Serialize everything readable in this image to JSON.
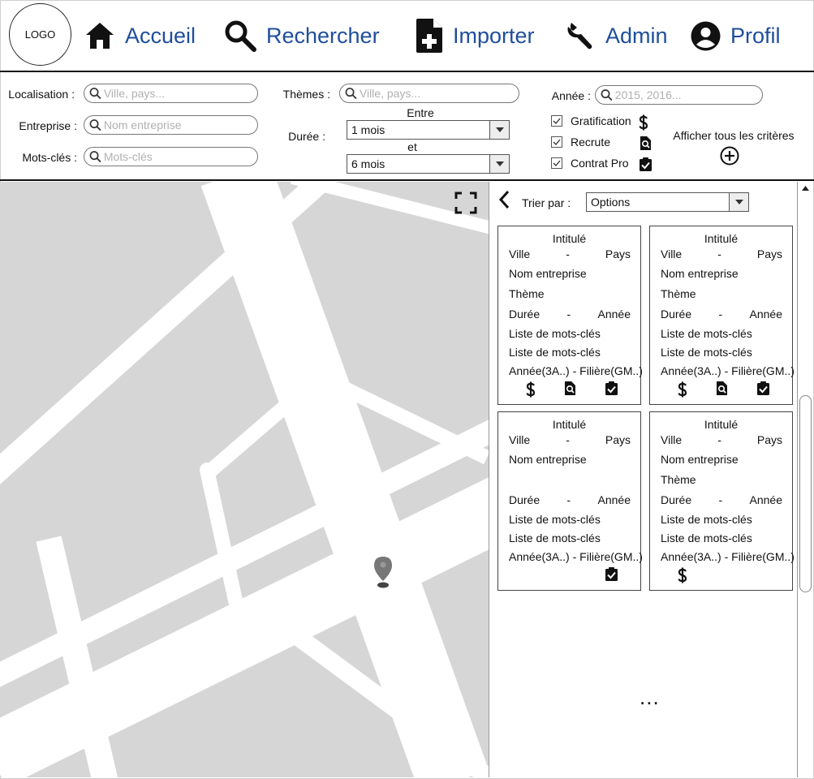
{
  "logo": "LOGO",
  "nav": {
    "home": "Accueil",
    "search": "Rechercher",
    "import": "Importer",
    "admin": "Admin",
    "profile": "Profil"
  },
  "filters": {
    "location_label": "Localisation :",
    "location_placeholder": "Ville, pays...",
    "company_label": "Entreprise :",
    "company_placeholder": "Nom entreprise",
    "keywords_label": "Mots-clés :",
    "keywords_placeholder": "Mots-clés",
    "themes_label": "Thèmes :",
    "themes_placeholder": "Ville, pays...",
    "duration_label": "Durée :",
    "between_label": "Entre",
    "and_label": "et",
    "duration_min": "1 mois",
    "duration_max": "6 mois",
    "year_label": "Année :",
    "year_placeholder": "2015, 2016...",
    "gratification_label": "Gratification",
    "recruits_label": "Recrute",
    "contract_label": "Contrat Pro",
    "gratification_checked": true,
    "recruits_checked": true,
    "contract_checked": true,
    "show_all_label": "Afficher tous les critères"
  },
  "results": {
    "sort_label": "Trier par :",
    "sort_value": "Options",
    "more": "...",
    "cards": [
      {
        "title": "Intitulé",
        "city": "Ville",
        "dash1": "-",
        "country": "Pays",
        "company": "Nom entreprise",
        "theme": "Thème",
        "duration": "Durée",
        "dash2": "-",
        "year": "Année",
        "keywords1": "Liste de mots-clés",
        "keywords2": "Liste de mots-clés",
        "program": "Année(3A..) - Filière(GM..)",
        "icons": [
          "dollar-icon",
          "recruit-search-icon",
          "contract-check-icon"
        ]
      },
      {
        "title": "Intitulé",
        "city": "Ville",
        "dash1": "-",
        "country": "Pays",
        "company": "Nom entreprise",
        "theme": "Thème",
        "duration": "Durée",
        "dash2": "-",
        "year": "Année",
        "keywords1": "Liste de mots-clés",
        "keywords2": "Liste de mots-clés",
        "program": "Année(3A..) - Filière(GM..)",
        "icons": [
          "dollar-icon",
          "recruit-search-icon",
          "contract-check-icon"
        ]
      },
      {
        "title": "Intitulé",
        "city": "Ville",
        "dash1": "-",
        "country": "Pays",
        "company": "Nom entreprise",
        "theme": "",
        "duration": "Durée",
        "dash2": "-",
        "year": "Année",
        "keywords1": "Liste de mots-clés",
        "keywords2": "Liste de mots-clés",
        "program": "Année(3A..) - Filière(GM..)",
        "icons": [
          "contract-check-icon"
        ]
      },
      {
        "title": "Intitulé",
        "city": "Ville",
        "dash1": "-",
        "country": "Pays",
        "company": "Nom entreprise",
        "theme": "Thème",
        "duration": "Durée",
        "dash2": "-",
        "year": "Année",
        "keywords1": "Liste de mots-clés",
        "keywords2": "Liste de mots-clés",
        "program": "Année(3A..) - Filière(GM..)",
        "icons": [
          "dollar-icon"
        ]
      }
    ]
  }
}
